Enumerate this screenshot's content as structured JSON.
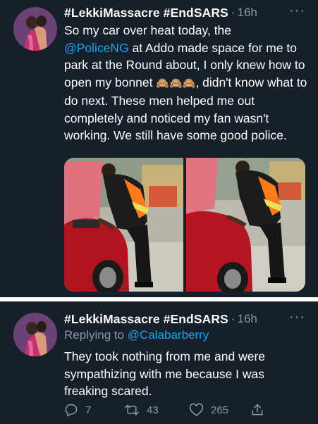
{
  "tweet1": {
    "author": "#LekkiMassacre #EndSARS",
    "separator": "·",
    "time": "16h",
    "text_part1": "So my car over heat today, the",
    "mention": "@PoliceNG",
    "text_part2": " at Addo made space for me to park at the Round about, I only knew how to open my bonnet ",
    "emojis": "🙈🙈🙈",
    "text_part3": ", didn't know what to do next. These men helped me out completely and noticed my fan wasn't working. We still have some good police.",
    "media": [
      "police officers fixing a red car photo",
      "police officers fixing a red car photo"
    ]
  },
  "tweet2": {
    "author": "#LekkiMassacre #EndSARS",
    "separator": "·",
    "time": "16h",
    "replying_label": "Replying to ",
    "replying_to": "@Calabarberry",
    "text": "They took nothing from me and were sympathizing with me because I was freaking scared.",
    "actions": {
      "replies": "7",
      "retweets": "43",
      "likes": "265"
    }
  },
  "more_glyph": "···",
  "colors": {
    "background": "#15202b",
    "text": "#ffffff",
    "muted": "#8899a6",
    "accent": "#1da1f2"
  }
}
